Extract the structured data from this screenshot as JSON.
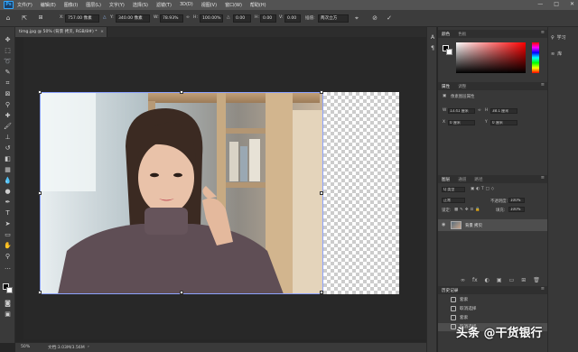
{
  "app": {
    "logo_text": "Ps"
  },
  "menubar": {
    "items": [
      "文件(F)",
      "编辑(E)",
      "图像(I)",
      "图层(L)",
      "文字(Y)",
      "选择(S)",
      "滤镜(T)",
      "3D(D)",
      "视图(V)",
      "窗口(W)",
      "帮助(H)"
    ],
    "window_controls": [
      "—",
      "□",
      "✕"
    ]
  },
  "options": {
    "x_label": "X:",
    "x_value": "757.00 像素",
    "y_label": "Y:",
    "y_value": "340.00 像素",
    "w_label": "W:",
    "w_value": "78.93%",
    "h_label": "H:",
    "h_value": "100.00%",
    "angle_label": "△",
    "angle_value": "0.00",
    "h_skew_label": "H:",
    "h_skew_value": "0.00",
    "v_skew_label": "V:",
    "v_skew_value": "0.00",
    "interp_label": "插值:",
    "interp_value": "两次立方",
    "cancel_glyph": "⊘",
    "commit_glyph": "✓"
  },
  "document": {
    "tab_title": "timg.jpg @ 50% (背景 拷贝, RGB/8#) *",
    "close_glyph": "×"
  },
  "status": {
    "zoom": "50%",
    "doc_info": "文档:3.03M/3.56M"
  },
  "color_panel": {
    "tabs": [
      "颜色",
      "色板"
    ]
  },
  "properties_panel": {
    "tabs": [
      "属性",
      "调整"
    ],
    "section": "像素图层属性",
    "w_label": "W",
    "w_value": "13.41 厘米",
    "h_label": "H",
    "h_value": "38.1 厘米",
    "x_value": "0 厘米",
    "y_value": "0 厘米",
    "go_label": "GO"
  },
  "layers_panel": {
    "tabs": [
      "图层",
      "通道",
      "路径"
    ],
    "kind_label": "Q 类型",
    "blend_mode": "正常",
    "opacity_label": "不透明度:",
    "opacity_value": "100%",
    "lock_label": "锁定:",
    "fill_label": "填充:",
    "fill_value": "100%",
    "layer_name": "背景 拷贝",
    "footer_icons": [
      "∞",
      "fx",
      "◐",
      "▣",
      "▭",
      "⊞",
      "🗑"
    ]
  },
  "history_panel": {
    "title": "历史记录",
    "items": [
      "套索",
      "取消选择",
      "套索",
      "取消选择"
    ]
  },
  "right_panel": {
    "items": [
      {
        "icon": "♀",
        "label": "学习"
      },
      {
        "icon": "≋",
        "label": "库"
      }
    ]
  },
  "watermark": {
    "text": "头条 @干货银行"
  },
  "colors": {
    "selection": "#8da3ff",
    "accent": "#31a8ff"
  }
}
